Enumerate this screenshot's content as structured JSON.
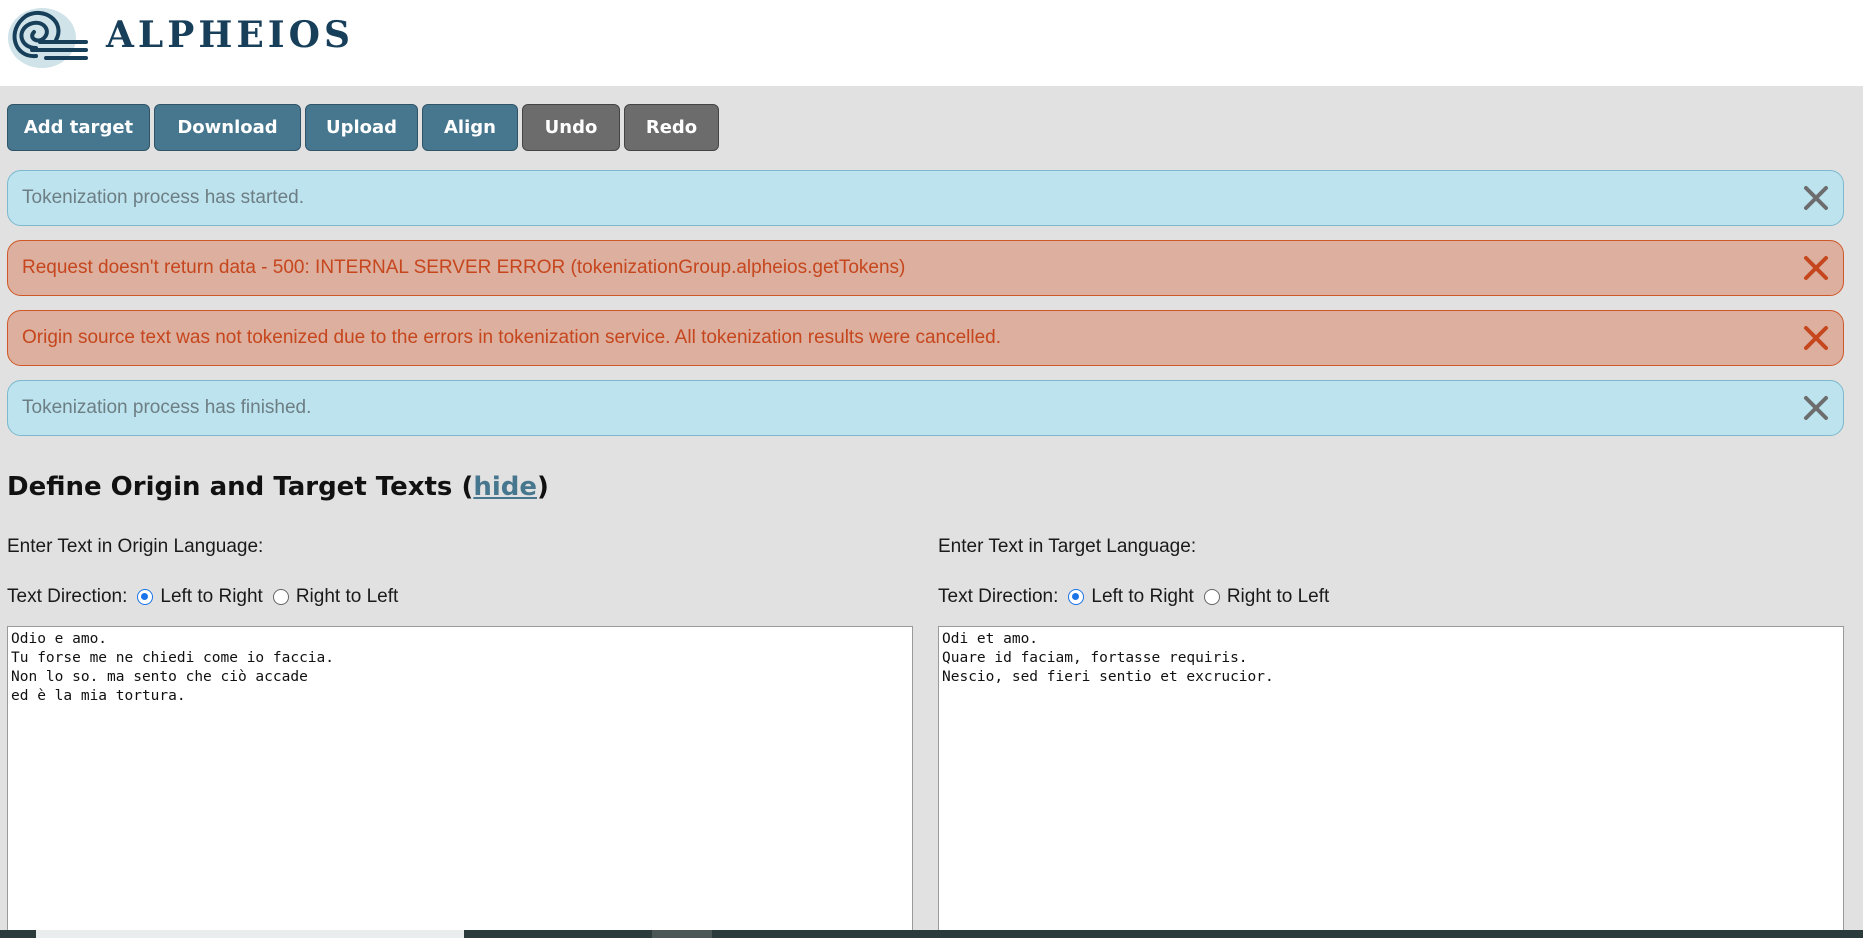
{
  "app": {
    "logo_text": "ALPHEIOS"
  },
  "toolbar": {
    "add_target": "Add target",
    "download": "Download",
    "upload": "Upload",
    "align": "Align",
    "undo": "Undo",
    "redo": "Redo"
  },
  "messages": [
    {
      "type": "info",
      "text": "Tokenization process has started."
    },
    {
      "type": "error",
      "text": "Request doesn't return data - 500: INTERNAL SERVER ERROR (tokenizationGroup.alpheios.getTokens)"
    },
    {
      "type": "error",
      "text": "Origin source text was not tokenized due to the errors in tokenization service. All tokenization results were cancelled."
    },
    {
      "type": "info",
      "text": "Tokenization process has finished."
    }
  ],
  "section": {
    "title_prefix": "Define Origin and Target Texts (",
    "hide_link": "hide",
    "title_suffix": ")"
  },
  "origin": {
    "label": "Enter Text in Origin Language:",
    "direction_label": "Text Direction:",
    "ltr": "Left to Right",
    "rtl": "Right to Left",
    "text": "Odio e amo.\nTu forse me ne chiedi come io faccia.\nNon lo so. ma sento che ciò accade\ned è la mia tortura."
  },
  "target": {
    "label": "Enter Text in Target Language:",
    "direction_label": "Text Direction:",
    "ltr": "Left to Right",
    "rtl": "Right to Left",
    "text": "Odi et amo.\nQuare id faciam, fortasse requiris.\nNescio, sed fieri sentio et excrucior."
  },
  "colors": {
    "primary_button": "#46778e",
    "secondary_button": "#6c6c6c",
    "info_bg": "#bce3ee",
    "error_bg": "#dcaf9e",
    "error_text": "#c6461d"
  }
}
